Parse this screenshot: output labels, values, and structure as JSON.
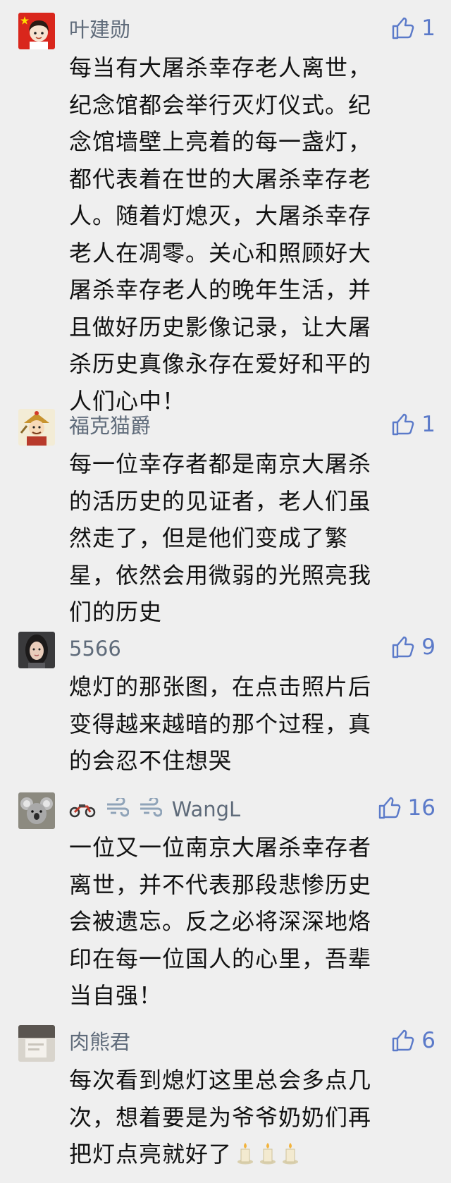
{
  "comments": [
    {
      "author": "叶建勋",
      "avatar_icon": "chinese-flag-avatar",
      "likes": "1",
      "lines": [
        "每当有大屠杀幸存老人离世，",
        "纪念馆都会举行灭灯仪式。纪",
        "念馆墙壁上亮着的每一盏灯，",
        "都代表着在世的大屠杀幸存老",
        "人。随着灯熄灭，大屠杀幸存",
        "老人在凋零。关心和照顾好大",
        "屠杀幸存老人的晚年生活，并",
        "且做好历史影像记录，让大屠",
        "杀历史真像永存在爱好和平的",
        "人们心中！"
      ]
    },
    {
      "author": "福克猫爵",
      "avatar_icon": "cartoon-general-avatar",
      "likes": "1",
      "lines": [
        "每一位幸存者都是南京大屠杀",
        "的活历史的见证者，老人们虽",
        "然走了，但是他们变成了繁",
        "星，依然会用微弱的光照亮我",
        "们的历史"
      ]
    },
    {
      "author": "5566",
      "avatar_icon": "portrait-avatar",
      "likes": "9",
      "lines": [
        "熄灯的那张图，在点击照片后",
        "变得越来越暗的那个过程，真",
        "的会忍不住想哭"
      ]
    },
    {
      "author": "WangL",
      "avatar_icon": "koala-avatar",
      "name_emojis": [
        "motorcycle-icon",
        "dash-icon",
        "dash-icon"
      ],
      "likes": "16",
      "lines": [
        "一位又一位南京大屠杀幸存者",
        "离世，并不代表那段悲惨历史",
        "会被遗忘。反之必将深深地烙",
        "印在每一位国人的心里，吾辈",
        "当自强！"
      ]
    },
    {
      "author": "肉熊君",
      "avatar_icon": "photo-avatar",
      "likes": "6",
      "lines": [
        "每次看到熄灯这里总会多点几",
        "次，想着要是为爷爷奶奶们再",
        "把灯点亮就好了"
      ],
      "trailing_emojis": [
        "candle-icon",
        "candle-icon",
        "candle-icon"
      ]
    }
  ],
  "colors": {
    "background": "#efefef",
    "author": "#5f6b7a",
    "like": "#5b7ac9",
    "text": "#111111"
  }
}
